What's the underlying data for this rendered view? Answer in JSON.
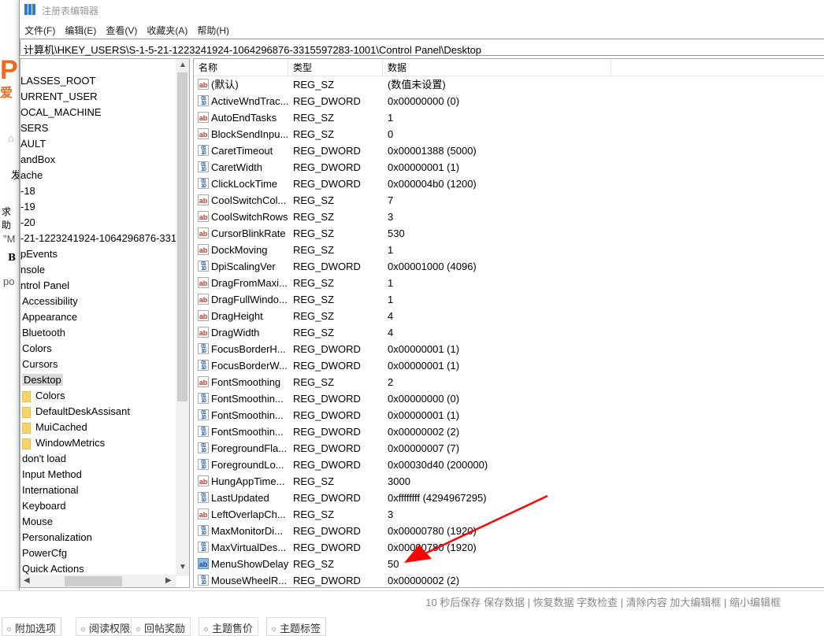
{
  "window": {
    "title": "注册表编辑器"
  },
  "menu": [
    "文件(F)",
    "编辑(E)",
    "查看(V)",
    "收藏夹(A)",
    "帮助(H)"
  ],
  "address": "计算机\\HKEY_USERS\\S-1-5-21-1223241924-1064296876-3315597283-1001\\Control Panel\\Desktop",
  "background_page": {
    "logo_letter": "P",
    "logo_sub": "爱",
    "home": "⌂",
    "post_label": "发",
    "help": "求助",
    "quote": "\"M",
    "bold": "B",
    "po": "po",
    "status": "10 秒后保存 保存数据 | 恢复数据   字数检查 | 清除内容   加大编辑框 | 缩小编辑框",
    "buttons": [
      "附加选项",
      "阅读权限",
      "回帖奖励",
      "主题售价",
      "主题标签"
    ]
  },
  "tree": {
    "items": [
      {
        "label": "LASSES_ROOT",
        "indent": 0
      },
      {
        "label": "URRENT_USER",
        "indent": 0
      },
      {
        "label": "OCAL_MACHINE",
        "indent": 0
      },
      {
        "label": "SERS",
        "indent": 0
      },
      {
        "label": "AULT",
        "indent": 0
      },
      {
        "label": "andBox",
        "indent": 0
      },
      {
        "label": "ache",
        "indent": 0
      },
      {
        "label": "-18",
        "indent": 0
      },
      {
        "label": "-19",
        "indent": 0
      },
      {
        "label": "-20",
        "indent": 0
      },
      {
        "label": "-21-1223241924-1064296876-331",
        "indent": 0
      },
      {
        "label": "pEvents",
        "indent": 0
      },
      {
        "label": "nsole",
        "indent": 0
      },
      {
        "label": "ntrol Panel",
        "indent": 0
      },
      {
        "label": "Accessibility",
        "indent": 1
      },
      {
        "label": "Appearance",
        "indent": 1
      },
      {
        "label": "Bluetooth",
        "indent": 1
      },
      {
        "label": "Colors",
        "indent": 1
      },
      {
        "label": "Cursors",
        "indent": 1
      },
      {
        "label": "Desktop",
        "indent": 1,
        "selected": true
      },
      {
        "label": "Colors",
        "indent": 2,
        "folder": true
      },
      {
        "label": "DefaultDeskAssisant",
        "indent": 2,
        "folder": true
      },
      {
        "label": "MuiCached",
        "indent": 2,
        "folder": true
      },
      {
        "label": "WindowMetrics",
        "indent": 2,
        "folder": true
      },
      {
        "label": "don't load",
        "indent": 1
      },
      {
        "label": "Input Method",
        "indent": 1
      },
      {
        "label": "International",
        "indent": 1
      },
      {
        "label": "Keyboard",
        "indent": 1
      },
      {
        "label": "Mouse",
        "indent": 1
      },
      {
        "label": "Personalization",
        "indent": 1
      },
      {
        "label": "PowerCfg",
        "indent": 1
      },
      {
        "label": "Quick Actions",
        "indent": 1
      }
    ]
  },
  "list": {
    "columns": [
      "名称",
      "类型",
      "数据"
    ],
    "rows": [
      [
        "(默认)",
        "REG_SZ",
        "(数值未设置)"
      ],
      [
        "ActiveWndTrac...",
        "REG_DWORD",
        "0x00000000 (0)"
      ],
      [
        "AutoEndTasks",
        "REG_SZ",
        "1"
      ],
      [
        "BlockSendInpu...",
        "REG_SZ",
        "0"
      ],
      [
        "CaretTimeout",
        "REG_DWORD",
        "0x00001388 (5000)"
      ],
      [
        "CaretWidth",
        "REG_DWORD",
        "0x00000001 (1)"
      ],
      [
        "ClickLockTime",
        "REG_DWORD",
        "0x000004b0 (1200)"
      ],
      [
        "CoolSwitchCol...",
        "REG_SZ",
        "7"
      ],
      [
        "CoolSwitchRows",
        "REG_SZ",
        "3"
      ],
      [
        "CursorBlinkRate",
        "REG_SZ",
        "530"
      ],
      [
        "DockMoving",
        "REG_SZ",
        "1"
      ],
      [
        "DpiScalingVer",
        "REG_DWORD",
        "0x00001000 (4096)"
      ],
      [
        "DragFromMaxi...",
        "REG_SZ",
        "1"
      ],
      [
        "DragFullWindo...",
        "REG_SZ",
        "1"
      ],
      [
        "DragHeight",
        "REG_SZ",
        "4"
      ],
      [
        "DragWidth",
        "REG_SZ",
        "4"
      ],
      [
        "FocusBorderH...",
        "REG_DWORD",
        "0x00000001 (1)"
      ],
      [
        "FocusBorderW...",
        "REG_DWORD",
        "0x00000001 (1)"
      ],
      [
        "FontSmoothing",
        "REG_SZ",
        "2"
      ],
      [
        "FontSmoothin...",
        "REG_DWORD",
        "0x00000000 (0)"
      ],
      [
        "FontSmoothin...",
        "REG_DWORD",
        "0x00000001 (1)"
      ],
      [
        "FontSmoothin...",
        "REG_DWORD",
        "0x00000002 (2)"
      ],
      [
        "ForegroundFla...",
        "REG_DWORD",
        "0x00000007 (7)"
      ],
      [
        "ForegroundLo...",
        "REG_DWORD",
        "0x00030d40 (200000)"
      ],
      [
        "HungAppTime...",
        "REG_SZ",
        "3000"
      ],
      [
        "LastUpdated",
        "REG_DWORD",
        "0xffffffff (4294967295)"
      ],
      [
        "LeftOverlapCh...",
        "REG_SZ",
        "3"
      ],
      [
        "MaxMonitorDi...",
        "REG_DWORD",
        "0x00000780 (1920)"
      ],
      [
        "MaxVirtualDes...",
        "REG_DWORD",
        "0x00000780 (1920)"
      ],
      [
        "MenuShowDelay",
        "REG_SZ",
        "50"
      ],
      [
        "MouseWheelR...",
        "REG_DWORD",
        "0x00000002 (2)"
      ]
    ],
    "highlighted": "MenuShowDelay"
  },
  "colors": {
    "annotation_arrow": "#ff0000",
    "logo": "#f26b1d",
    "selection": "#d9d9d9"
  }
}
